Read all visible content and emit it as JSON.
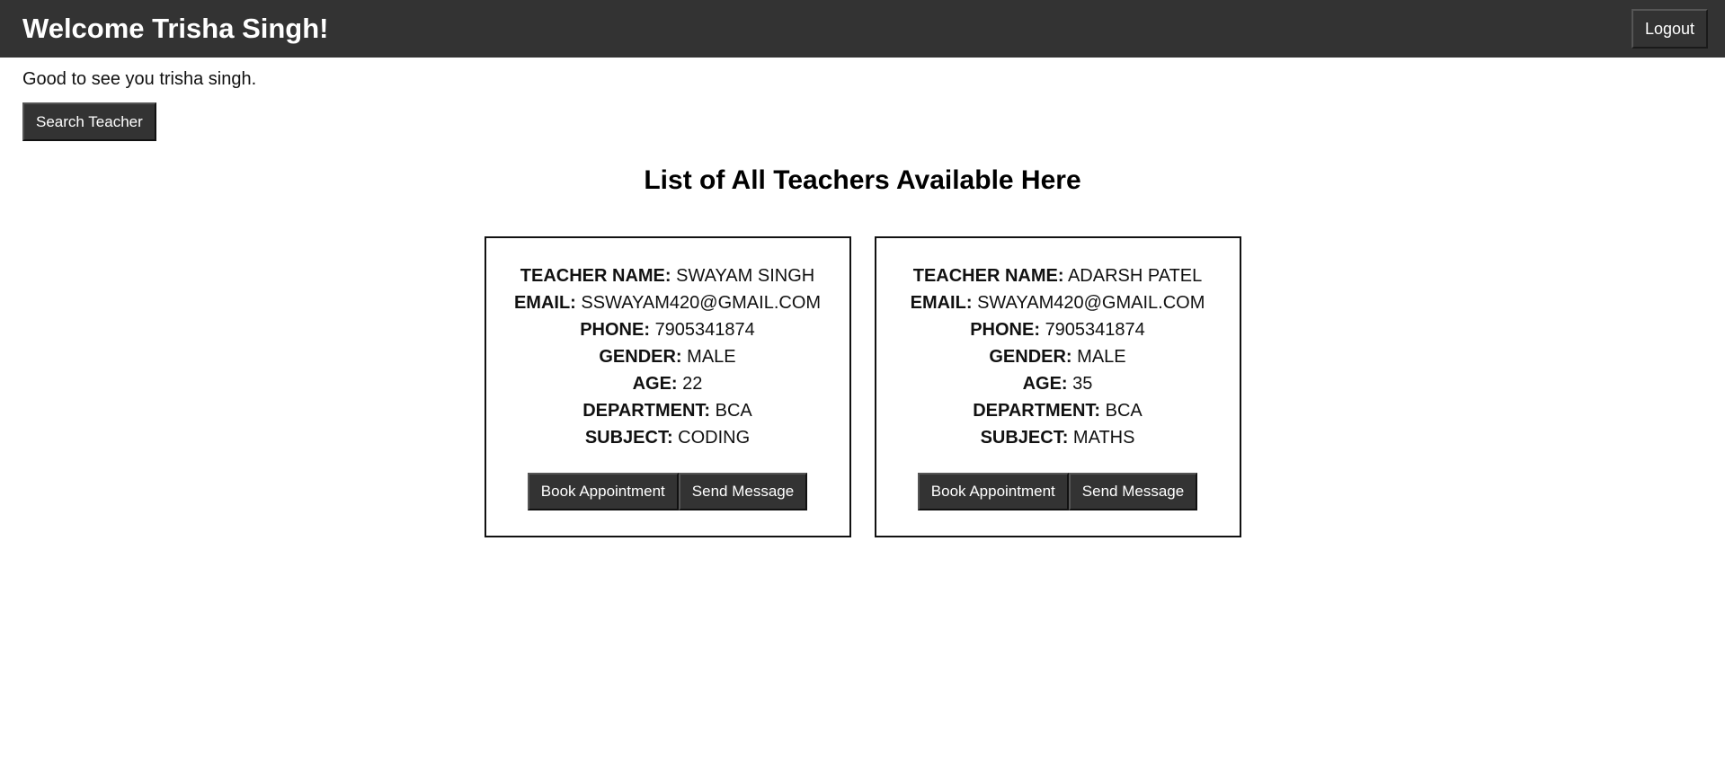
{
  "header": {
    "title": "Welcome Trisha Singh!",
    "logout_label": "Logout"
  },
  "greeting": "Good to see you trisha singh.",
  "search_button_label": "Search Teacher",
  "list_title": "List of All Teachers Available Here",
  "field_labels": {
    "name": "TEACHER NAME:",
    "email": "EMAIL:",
    "phone": "PHONE:",
    "gender": "GENDER:",
    "age": "AGE:",
    "department": "DEPARTMENT:",
    "subject": "SUBJECT:"
  },
  "teachers": [
    {
      "name": "SWAYAM SINGH",
      "email": "SSWAYAM420@GMAIL.COM",
      "phone": "7905341874",
      "gender": "MALE",
      "age": "22",
      "department": "BCA",
      "subject": "CODING",
      "book_label": "Book Appointment",
      "message_label": "Send Message"
    },
    {
      "name": "ADARSH PATEL",
      "email": "SWAYAM420@GMAIL.COM",
      "phone": "7905341874",
      "gender": "MALE",
      "age": "35",
      "department": "BCA",
      "subject": "MATHS",
      "book_label": "Book Appointment",
      "message_label": "Send Message"
    }
  ],
  "colors": {
    "header_bg": "#333333",
    "button_bg": "#333333",
    "button_text": "#ffffff"
  }
}
